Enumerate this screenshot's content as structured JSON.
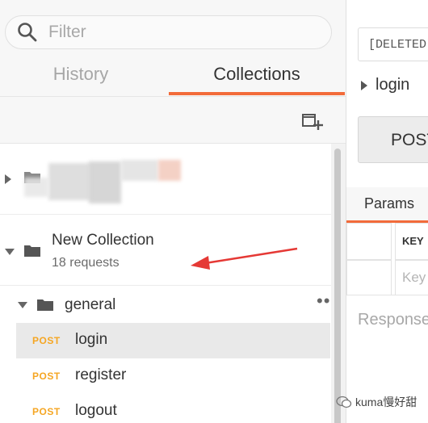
{
  "search": {
    "placeholder": "Filter"
  },
  "tabs": {
    "history": "History",
    "collections": "Collections"
  },
  "collections": [
    {
      "name": "New Collection",
      "subtitle": "18 requests",
      "expanded": true,
      "folders": [
        {
          "name": "general",
          "requests": [
            {
              "method": "POST",
              "name": "login",
              "active": true
            },
            {
              "method": "POST",
              "name": "register",
              "active": false
            },
            {
              "method": "POST",
              "name": "logout",
              "active": false
            }
          ]
        }
      ]
    }
  ],
  "request_pane": {
    "environment": "[DELETED]",
    "title": "login",
    "method": "POST",
    "params_tab": "Params",
    "table_header_key": "KEY",
    "key_placeholder": "Key",
    "response_label": "Response"
  },
  "watermark": {
    "text": "kuma慢好甜"
  },
  "colors": {
    "accent": "#f26b3a",
    "post_method": "#f5a623",
    "arrow": "#e53935"
  }
}
